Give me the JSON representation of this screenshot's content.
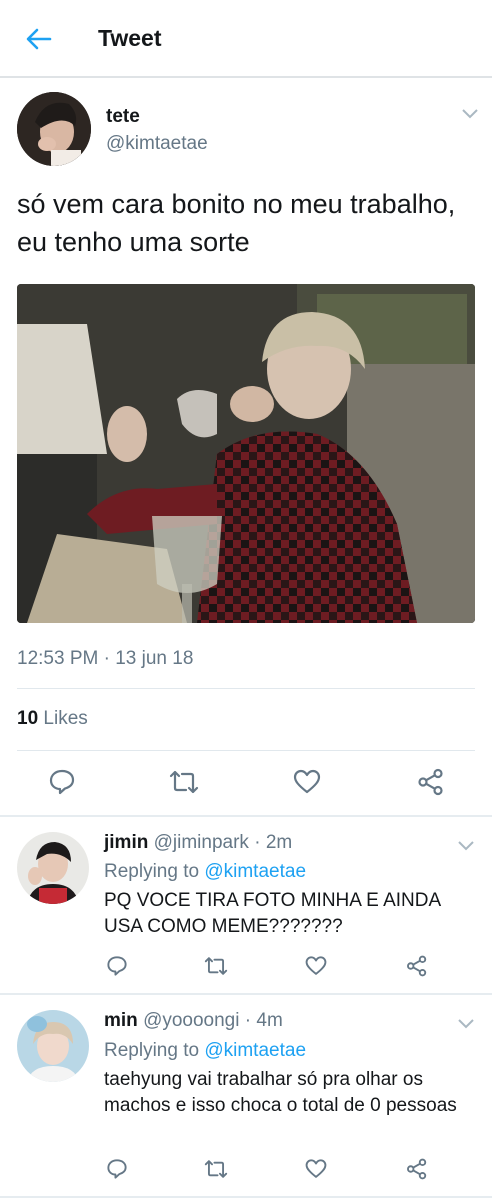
{
  "header": {
    "title": "Tweet",
    "back_icon": "arrow-left-icon"
  },
  "tweet": {
    "name": "tete",
    "handle": "@kimtaetae",
    "text": "só vem cara bonito no meu trabalho, eu tenho uma sorte",
    "timestamp": "12:53 PM · 13 jun 18",
    "likes_count": "10",
    "likes_label": "Likes",
    "actions": [
      "reply-icon",
      "retweet-icon",
      "like-icon",
      "share-icon"
    ]
  },
  "replies": [
    {
      "name": "jimin",
      "handle": "@jiminpark",
      "time": "· 2m",
      "replying_label": "Replying to",
      "replying_to": "@kimtaetae",
      "text": "PQ VOCE TIRA FOTO MINHA E AINDA USA COMO MEME???????"
    },
    {
      "name": "min",
      "handle": "@yoooongi",
      "time": "· 4m",
      "replying_label": "Replying to",
      "replying_to": "@kimtaetae",
      "text": "taehyung vai trabalhar só pra olhar os machos e isso choca o total de 0 pessoas"
    }
  ],
  "colors": {
    "accent": "#1da1f2",
    "icon": "#657786",
    "text": "#14171a"
  }
}
